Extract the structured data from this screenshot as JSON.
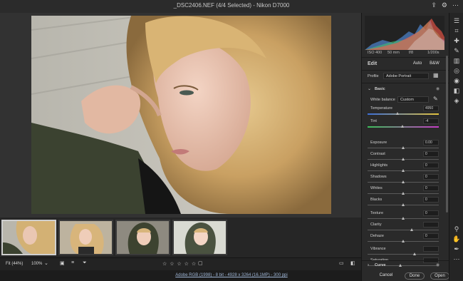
{
  "window": {
    "title": "_DSC2406.NEF (4/4 Selected)  -  Nikon D7000"
  },
  "titlebar_icons": [
    "export-icon",
    "settings-icon",
    "more-icon"
  ],
  "filmstrip": {
    "selected_index": 0,
    "count": 4
  },
  "bottombar": {
    "zoom_fit": "Fit (44%)",
    "zoom_100": "100%",
    "stars": "☆ ☆ ☆ ☆ ☆"
  },
  "status": {
    "text": "Adobe RGB (1998) - 8 bit - 4928 x 3264 (16.1MP) - 300 ppi"
  },
  "panel": {
    "meta": {
      "iso": "ISO 400",
      "focal": "50 mm",
      "aperture": "f/8",
      "shutter": "1/200s"
    },
    "edit_title": "Edit",
    "auto_label": "Auto",
    "bw_label": "B&W",
    "profile_label": "Profile",
    "profile_value": "Adobe Portrait",
    "basic_title": "Basic",
    "white_balance_label": "White balance",
    "white_balance_value": "Custom",
    "sliders": [
      {
        "label": "Temperature",
        "value": "4950",
        "pos": 0.42,
        "color": "temp"
      },
      {
        "label": "Tint",
        "value": "-4",
        "pos": 0.49,
        "color": "tint"
      },
      {
        "label": "Exposure",
        "value": "0.00",
        "pos": 0.5
      },
      {
        "label": "Contrast",
        "value": "0",
        "pos": 0.5
      },
      {
        "label": "Highlights",
        "value": "0",
        "pos": 0.5
      },
      {
        "label": "Shadows",
        "value": "0",
        "pos": 0.5
      },
      {
        "label": "Whites",
        "value": "0",
        "pos": 0.5
      },
      {
        "label": "Blacks",
        "value": "0",
        "pos": 0.5
      },
      {
        "label": "Texture",
        "value": "0",
        "pos": 0.5
      },
      {
        "label": "Clarity",
        "value": "",
        "pos": 0.62
      },
      {
        "label": "Dehaze",
        "value": "0",
        "pos": 0.5
      },
      {
        "label": "Vibrance",
        "value": "",
        "pos": 0.66
      },
      {
        "label": "Saturation",
        "value": "",
        "pos": 0.46
      }
    ],
    "curve_title": "Curve",
    "cancel_label": "Cancel",
    "done_label": "Done",
    "open_label": "Open"
  },
  "rail_icons": [
    "edit-sliders-icon",
    "crop-icon",
    "healing-icon",
    "brush-icon",
    "linear-gradient-icon",
    "radial-gradient-icon",
    "red-eye-icon",
    "snapshots-icon",
    "presets-icon",
    "zoom-icon",
    "hand-icon",
    "color-sampler-icon",
    "more-icon"
  ]
}
